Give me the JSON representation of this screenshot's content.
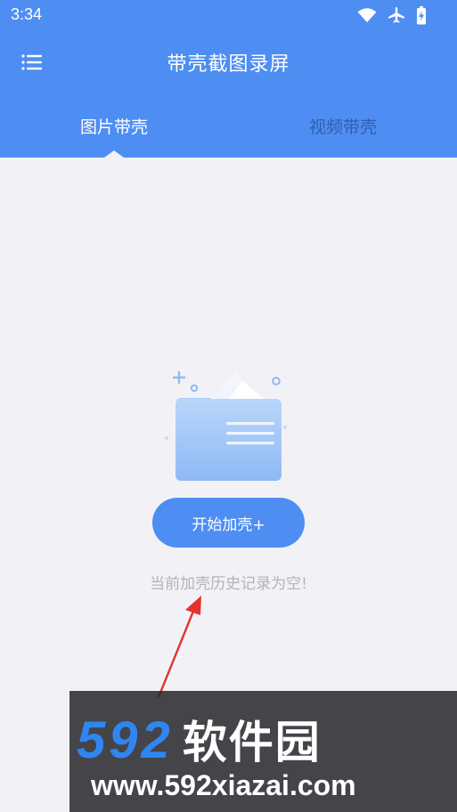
{
  "status_bar": {
    "time": "3:34",
    "icons": [
      "wifi-icon",
      "airplane-mode-icon",
      "battery-charging-icon"
    ]
  },
  "header": {
    "title": "带壳截图录屏",
    "menu_icon": "menu-list-icon",
    "background_color": "#4e8ef3"
  },
  "tabs": [
    {
      "label": "图片带壳",
      "active": true
    },
    {
      "label": "视频带壳",
      "active": false
    }
  ],
  "main": {
    "illustration_icon": "empty-folder-icon",
    "start_button_label": "开始加壳+",
    "empty_message": "当前加壳历史记录为空!"
  },
  "watermark": {
    "logo_number": "592",
    "logo_text": "软件园",
    "url": "www.592xiazai.com"
  }
}
